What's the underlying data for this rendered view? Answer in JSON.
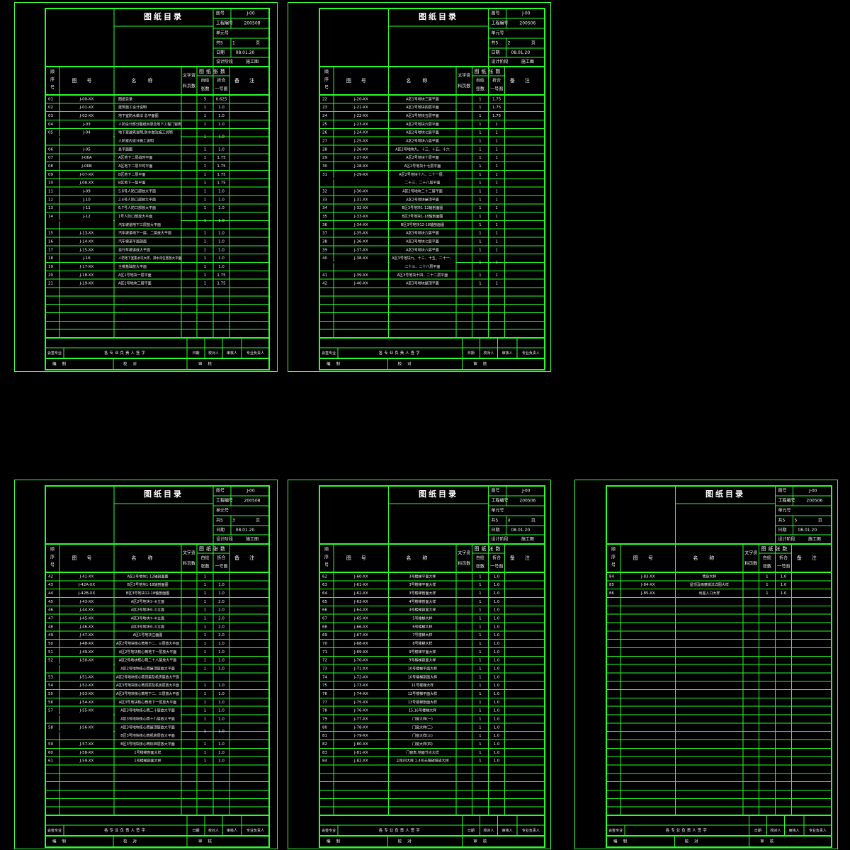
{
  "header": {
    "title": "图纸目录",
    "drawing_no_label": "图号",
    "drawing_no": "J-00",
    "project_no_label": "工程编号",
    "unit_no_label": "单元号",
    "total_pages": "共5",
    "page_label": "页",
    "date_label": "日期",
    "date": "08.01.20",
    "stage_label": "设计阶段",
    "stage": "施工图"
  },
  "columns": {
    "seq": "顺序号",
    "code": "图号",
    "name": "名称",
    "doc_source": "文字资料页数",
    "sheet_count": "图纸张数",
    "sheet_self": "自绘张数",
    "sheet_equiv": "折合一号图",
    "remark": "备注"
  },
  "footer": {
    "sig_label": "会签专业",
    "chief_label": "各专业负责人签字",
    "date_label": "日期",
    "proof_label": "校对人",
    "review_label": "审核人",
    "lead_label": "专业负责人",
    "make_label": "编制",
    "check_label": "校对",
    "audit_label": "审核"
  },
  "sheets": [
    {
      "project_no": "200508",
      "page_no": "1",
      "rows": [
        {
          "seq": "01",
          "code": "J-00-XX",
          "name": "图纸目录",
          "c": "5",
          "e": "0.625"
        },
        {
          "seq": "02",
          "code": "J-01-XX",
          "name": "建筑施工设计说明",
          "c": "1",
          "e": "1.0"
        },
        {
          "seq": "03",
          "code": "J-02-XX",
          "name": "地下室防水做法 总平面图",
          "c": "1",
          "e": "1.0"
        },
        {
          "seq": "04",
          "code": "J-03",
          "name": "人防设计部分图纸目录及地下工程门窗表",
          "c": "1",
          "e": "1.0"
        },
        {
          "seq": "05",
          "code": "J-04",
          "name": "地下室建筑说明,防水做法施工说明",
          "name2": "人防室内设计施工说明",
          "c": "1",
          "e": "1.0"
        },
        {
          "seq": "06",
          "code": "J-05",
          "name": "总平面图",
          "c": "1",
          "e": "1.0"
        },
        {
          "seq": "07",
          "code": "J-06A",
          "name": "A区地下二层战时平面",
          "c": "1",
          "e": "1.75"
        },
        {
          "seq": "08",
          "code": "J-06B",
          "name": "A区地下二层平时平面",
          "c": "1",
          "e": "1.75"
        },
        {
          "seq": "09",
          "code": "J-07-XX",
          "name": "B区地下二层平面",
          "c": "1",
          "e": "1.75"
        },
        {
          "seq": "10",
          "code": "J-08-XX",
          "name": "B区地下一层平面",
          "c": "1",
          "e": "1.75"
        },
        {
          "seq": "11",
          "code": "J-09",
          "name": "5,6号人防口部放大平面",
          "c": "1",
          "e": "1.0"
        },
        {
          "seq": "12",
          "code": "J-10",
          "name": "2,4号人防口部放大平面",
          "c": "1",
          "e": "1.0"
        },
        {
          "seq": "13",
          "code": "J-11",
          "name": "6,7号人防口部放大平面",
          "c": "1",
          "e": "1.0"
        },
        {
          "seq": "14",
          "code": "J-12",
          "name": "1号人防口部放大平面",
          "name2": "汽车坡道地下三层放大平面",
          "c": "1",
          "e": "1.0"
        },
        {
          "seq": "15",
          "code": "J-13-XX",
          "name": "汽车坡道地下一层、二层放大平面",
          "c": "1",
          "e": "1.0"
        },
        {
          "seq": "16",
          "code": "J-14-XX",
          "name": "汽车坡道平面剖面",
          "c": "1",
          "e": "1.0"
        },
        {
          "seq": "17",
          "code": "J-15-XX",
          "name": "自行车坡道放大平面",
          "c": "1",
          "e": "1.0"
        },
        {
          "seq": "18",
          "code": "J-16",
          "name": "人防地下室集水坑大样、排水沟位置放大平面",
          "c": "1",
          "e": "1.0"
        },
        {
          "seq": "19",
          "code": "J-17-XX",
          "name": "主楼基础放大平面",
          "c": "1",
          "e": "1.0"
        },
        {
          "seq": "20",
          "code": "J-18-XX",
          "name": "A区1号地块一层平面",
          "c": "1",
          "e": "1.75"
        },
        {
          "seq": "21",
          "code": "J-19-XX",
          "name": "A区1号地块二层平面",
          "c": "1",
          "e": "1.75"
        }
      ]
    },
    {
      "project_no": "200506",
      "page_no": "2",
      "rows": [
        {
          "seq": "22",
          "code": "J-20-XX",
          "name": "A区1号地块三层平面",
          "c": "1",
          "e": "1.75"
        },
        {
          "seq": "23",
          "code": "J-21-XX",
          "name": "A区1号地块四层平面",
          "c": "1",
          "e": "1.75"
        },
        {
          "seq": "24",
          "code": "J-22-XX",
          "name": "A区1号地块五层平面",
          "c": "1",
          "e": "1.75"
        },
        {
          "seq": "25",
          "code": "J-23-XX",
          "name": "A区2号地块六层平面",
          "c": "1",
          "e": "1"
        },
        {
          "seq": "26",
          "code": "J-24-XX",
          "name": "A区2号地块七层平面",
          "c": "1",
          "e": "1"
        },
        {
          "seq": "27",
          "code": "J-25-XX",
          "name": "A区2号地块八层平面",
          "c": "1",
          "e": "1"
        },
        {
          "seq": "28",
          "code": "J-26-XX",
          "name": "A区2号地块九、十三、十五、十六",
          "c": "1",
          "e": "1"
        },
        {
          "seq": "29",
          "code": "J-27-XX",
          "name": "A区2号地块十层平面",
          "c": "1",
          "e": "1"
        },
        {
          "seq": "30",
          "code": "J-28-XX",
          "name": "A区2号地块十七层平面",
          "c": "1",
          "e": "1"
        },
        {
          "seq": "31",
          "code": "J-29-XX",
          "name": "A区2号地块十八、二十一层、",
          "name2": "二十三、二十八层平面",
          "c": "1",
          "e": "1",
          "c2": "1",
          "e2": "1"
        },
        {
          "seq": "32",
          "code": "J-30-XX",
          "name": "A区2号地块二十二层平面",
          "c": "1",
          "e": "1"
        },
        {
          "seq": "33",
          "code": "J-31-XX",
          "name": "A区2号地块屋顶平面",
          "c": "1",
          "e": "1"
        },
        {
          "seq": "34",
          "code": "J-32-XX",
          "name": "B区3号地块1-12轴剖面图",
          "c": "1",
          "e": "1"
        },
        {
          "seq": "35",
          "code": "J-33-XX",
          "name": "B区3号地块1-18轴剖面图",
          "c": "1",
          "e": "1"
        },
        {
          "seq": "36",
          "code": "J-34-XX",
          "name": "B区3号地块12-18轴剖面图",
          "c": "1",
          "e": "1"
        },
        {
          "seq": "37",
          "code": "J-35-XX",
          "name": "A区3号地块六层平面",
          "c": "1",
          "e": "1"
        },
        {
          "seq": "38",
          "code": "J-36-XX",
          "name": "A区3号地块七层平面",
          "c": "1",
          "e": "1"
        },
        {
          "seq": "39",
          "code": "J-37-XX",
          "name": "A区3号地块八层平面",
          "c": "1",
          "e": "1"
        },
        {
          "seq": "40",
          "code": "J-38-XX",
          "name": "A区3号地块九、十三、十五、二十一、",
          "name2": "二十三、二十八层平面",
          "c": "1",
          "e": "1"
        },
        {
          "seq": "41",
          "code": "J-39-XX",
          "name": "A区3号地块十四、二十二层平面",
          "c": "1",
          "e": "1"
        },
        {
          "seq": "42",
          "code": "J-40-XX",
          "name": "A区3号地块屋顶平面",
          "c": "1",
          "e": "1"
        }
      ]
    },
    {
      "project_no": "200508",
      "page_no": "3",
      "rows": [
        {
          "seq": "42",
          "code": "J-41-XX",
          "name": "A区2号地块1-12轴剖面图",
          "c": "1",
          "e": ""
        },
        {
          "seq": "43",
          "code": "J-42A-XX",
          "name": "B区3号地块1-18轴剖面图",
          "c": "1",
          "e": "1.0"
        },
        {
          "seq": "44",
          "code": "J-42B-XX",
          "name": "B区3号地块12-18轴剖面图",
          "c": "1",
          "e": "1.0"
        },
        {
          "seq": "45",
          "code": "J-43-XX",
          "name": "A区2号地块①-⑥立面",
          "c": "1",
          "e": "2.0"
        },
        {
          "seq": "46",
          "code": "J-44-XX",
          "name": "A区2号地块⑥-①立面",
          "c": "1",
          "e": "2.0"
        },
        {
          "seq": "47",
          "code": "J-45-XX",
          "name": "A区3号地块①-⑥立面",
          "c": "1",
          "e": "2.0"
        },
        {
          "seq": "48",
          "code": "J-46-XX",
          "name": "A区3号地块⑥-①立面",
          "c": "1",
          "e": "2.0"
        },
        {
          "seq": "49",
          "code": "J-47-XX",
          "name": "A区1号地块立面图",
          "c": "1",
          "e": "2.0"
        },
        {
          "seq": "50",
          "code": "J-48-XX",
          "name": "A区2号地块核心筒地下二、三层放大平面",
          "c": "1",
          "e": "1.0"
        },
        {
          "seq": "51",
          "code": "J-49-XX",
          "name": "A区2号地块核心筒地下一层放大平面",
          "c": "1",
          "e": "1.0"
        },
        {
          "seq": "52",
          "code": "J-50-XX",
          "name": "A区2号地块核心筒二十八层放大平面",
          "name2": "A区2号地块核心筒屋顶层放大平面",
          "c": "1",
          "e": "1.0",
          "c2": "1",
          "e2": "1.0"
        },
        {
          "seq": "53",
          "code": "J-51-XX",
          "name": "A区2号地块核心筒顶层及机房层放大平面",
          "c": "",
          "e": ""
        },
        {
          "seq": "54",
          "code": "J-52-XX",
          "name": "A区3号地块核心筒顶层及机房层放大平面",
          "c": "1",
          "e": "1.0"
        },
        {
          "seq": "55",
          "code": "J-53-XX",
          "name": "A区3号地块核心筒地下二、三层放大平面",
          "c": "1",
          "e": "1.0"
        },
        {
          "seq": "56",
          "code": "J-54-XX",
          "name": "A区3号地块核心筒地下一层放大平面",
          "c": "1",
          "e": "1.0"
        },
        {
          "seq": "57",
          "code": "J-55-XX",
          "name": "A区3号地块核心筒二十层放大平面",
          "name2": "A区3号地块核心筒十九层放大平面",
          "c": "1",
          "e": "1.0",
          "c2": "1",
          "e2": "1.0"
        },
        {
          "seq": "58",
          "code": "J-56-XX",
          "name": "A区3号地块核心筒屋顶层放大平面",
          "name2": "B区3号地块核心筒机房层放大平面",
          "c": "1",
          "e": "1.0"
        },
        {
          "seq": "59",
          "code": "J-57-XX",
          "name": "B区3号地块核心筒标准层放大平面",
          "c": "1",
          "e": "1.0"
        },
        {
          "seq": "60",
          "code": "J-58-XX",
          "name": "1号楼梯剖面大样",
          "c": "1",
          "e": "1.0"
        },
        {
          "seq": "61",
          "code": "J-59-XX",
          "name": "1号楼梯剖面大样",
          "c": "1",
          "e": "1.0"
        }
      ]
    },
    {
      "project_no": "200506",
      "page_no": "4",
      "rows": [
        {
          "seq": "62",
          "code": "J-60-XX",
          "name": "3号楼梯平面大样",
          "c": "1",
          "e": "1.0"
        },
        {
          "seq": "63",
          "code": "J-61-XX",
          "name": "3号楼梯平面大样",
          "c": "1",
          "e": "1.0"
        },
        {
          "seq": "64",
          "code": "J-62-XX",
          "name": "3号楼梯剖面大样",
          "c": "1",
          "e": "1.0"
        },
        {
          "seq": "65",
          "code": "J-63-XX",
          "name": "4号楼梯剖面大样",
          "c": "1",
          "e": "1.0"
        },
        {
          "seq": "66",
          "code": "J-64-XX",
          "name": "4号楼梯剖面大样",
          "c": "1",
          "e": "1.0"
        },
        {
          "seq": "67",
          "code": "J-65-XX",
          "name": "5号楼梯大样",
          "c": "1",
          "e": "1.0"
        },
        {
          "seq": "68",
          "code": "J-66-XX",
          "name": "6号楼梯大样",
          "c": "1",
          "e": "1.0"
        },
        {
          "seq": "69",
          "code": "J-67-XX",
          "name": "7号楼梯大样",
          "c": "1",
          "e": "1.0"
        },
        {
          "seq": "70",
          "code": "J-68-XX",
          "name": "8号楼梯大样",
          "c": "1",
          "e": "1.0"
        },
        {
          "seq": "71",
          "code": "J-69-XX",
          "name": "9号楼梯平面大样",
          "c": "1",
          "e": "1.0"
        },
        {
          "seq": "72",
          "code": "J-70-XX",
          "name": "9号楼梯剖面大样",
          "c": "1",
          "e": "1.0"
        },
        {
          "seq": "73",
          "code": "J-71-XX",
          "name": "10号楼梯平面大样",
          "c": "1",
          "e": "1.0"
        },
        {
          "seq": "74",
          "code": "J-72-XX",
          "name": "10号楼梯剖面大样",
          "c": "1",
          "e": "1.0"
        },
        {
          "seq": "75",
          "code": "J-73-XX",
          "name": "11号楼梯大样",
          "c": "1",
          "e": "1.0"
        },
        {
          "seq": "76",
          "code": "J-74-XX",
          "name": "12号楼梯平面大样",
          "c": "1",
          "e": "1.0"
        },
        {
          "seq": "77",
          "code": "J-75-XX",
          "name": "13号楼梯剖面大样",
          "c": "1",
          "e": "1.0"
        },
        {
          "seq": "78",
          "code": "J-76-XX",
          "name": "15,16号楼梯大样",
          "c": "1",
          "e": "1.0"
        },
        {
          "seq": "79",
          "code": "J-77-XX",
          "name": "门窗大样(一)",
          "c": "1",
          "e": "1.0"
        },
        {
          "seq": "80",
          "code": "J-78-XX",
          "name": "门窗大样(二)",
          "c": "1",
          "e": "1.0"
        },
        {
          "seq": "81",
          "code": "J-79-XX",
          "name": "门窗大样(三)",
          "c": "1",
          "e": "1.0"
        },
        {
          "seq": "82",
          "code": "J-80-XX",
          "name": "门窗大样(四)",
          "c": "1",
          "e": "1.0"
        },
        {
          "seq": "83",
          "code": "J-81-XX",
          "name": "门窗表,地面节点大样",
          "c": "1",
          "e": "1.0"
        },
        {
          "seq": "84",
          "code": "J-82-XX",
          "name": "卫生间大样 1-4号无障碍坡道大样",
          "c": "1",
          "e": "1.0"
        }
      ]
    },
    {
      "project_no": "200506",
      "page_no": "5",
      "rows": [
        {
          "seq": "84",
          "code": "J-83-XX",
          "name": "墙身大样",
          "c": "1",
          "e": "1.0"
        },
        {
          "seq": "85",
          "code": "J-84-XX",
          "name": "屋顶及雨蓬做法详图大样",
          "c": "1",
          "e": "1.0"
        },
        {
          "seq": "86",
          "code": "J-85-XX",
          "name": "出屋入口大样",
          "c": "1",
          "e": "1.0"
        }
      ]
    }
  ]
}
